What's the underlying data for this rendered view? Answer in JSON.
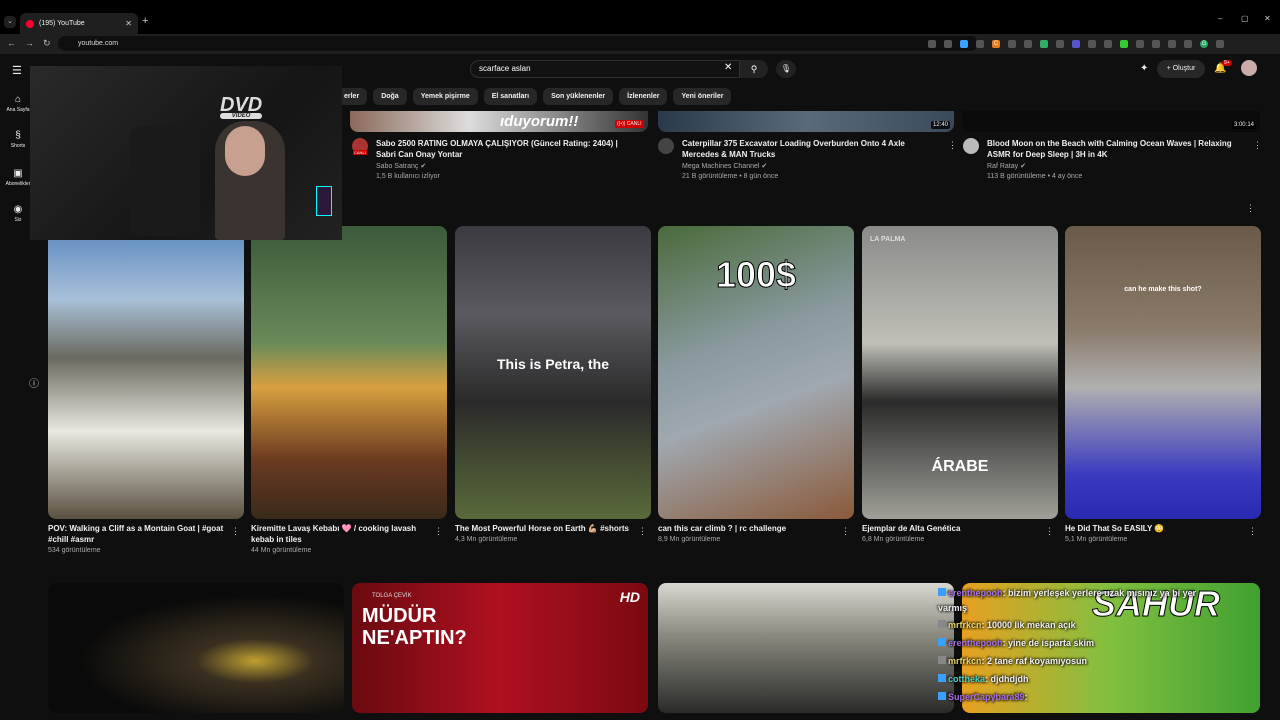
{
  "browser": {
    "tab_title": "(195) YouTube",
    "new_tab": "+",
    "url": "youtube.com",
    "window_controls": [
      "–",
      "▢",
      "✕"
    ],
    "ext_labels": [
      "C",
      "G"
    ]
  },
  "youtube": {
    "search_query": "scarface aslan",
    "create_label": "Oluştur",
    "notification_count": "9+",
    "chips": [
      "erler",
      "Doğa",
      "Yemek pişirme",
      "El sanatları",
      "Son yüklenenler",
      "İzlenenler",
      "Yeni öneriler"
    ],
    "sidebar": [
      {
        "label": "Ana Sayfa",
        "icon": "home-icon"
      },
      {
        "label": "Shorts",
        "icon": "shorts-icon"
      },
      {
        "label": "Abonelikler",
        "icon": "subscriptions-icon"
      },
      {
        "label": "Siz",
        "icon": "you-icon"
      }
    ],
    "top_videos": [
      {
        "title": "Sabo 2500 RATING OLMAYA ÇALIŞIYOR (Güncel Rating: 2404) | Sabri Can Onay Yontar",
        "channel": "Sabo Satranç ✔",
        "stats": "1,5 B kullanıcı izliyor",
        "badge": "CANLI",
        "thumb_text": "ıduyorum!!",
        "thumb_badge": "((•)) CANLI"
      },
      {
        "title": "Caterpillar 375 Excavator Loading Overburden Onto 4 Axle Mercedes & MAN Trucks",
        "channel": "Mega Machines Channel ✔",
        "stats": "21 B görüntüleme • 8 gün önce",
        "duration": "12:40"
      },
      {
        "title": "Blood Moon on the Beach with Calming Ocean Waves | Relaxing ASMR for Deep Sleep | 3H in 4K",
        "channel": "Raf Ratay ✔",
        "stats": "113 B görüntüleme • 4 ay önce",
        "duration": "3:00:14"
      }
    ],
    "shorts": [
      {
        "title": "POV: Walking a Cliff as a Montain Goat | #goat #chill #asmr",
        "views": "534 görüntüleme",
        "overlay": ""
      },
      {
        "title": "Kiremitte Lavaş Kebabı 🩷 / cooking lavash kebab in tiles",
        "views": "44 Mn görüntüleme",
        "overlay": ""
      },
      {
        "title": "The Most Powerful Horse on Earth 💪🏼 #shorts",
        "views": "4,3 Mn görüntüleme",
        "overlay": "This is Petra, the"
      },
      {
        "title": "can this car climb ? | rc challenge",
        "views": "8,9 Mn görüntüleme",
        "overlay": "100$"
      },
      {
        "title": "Ejemplar de Alta Genética",
        "views": "6,8 Mn görüntüleme",
        "overlay": "ÁRABE",
        "top_label": "LA PALMA"
      },
      {
        "title": "He Did That So EASILY 😳",
        "views": "5,1 Mn görüntüleme",
        "overlay": "can he make this shot?"
      }
    ],
    "bottom_thumbs": [
      {
        "text": ""
      },
      {
        "text": "MÜDÜR NE'APTIN?",
        "small": "TOLGA ÇEVİK",
        "hd": "HD"
      },
      {
        "text": ""
      },
      {
        "text": "SAHUR"
      }
    ]
  },
  "stream_overlay": {
    "dvd_text": "DVD",
    "dvd_sub": "VIDEO"
  },
  "chat": [
    {
      "user": "erenthepooh",
      "msg": ": bizim yerleşek yerlere uzak mısınız ya bi yer",
      "color": "u2"
    },
    {
      "user": "",
      "msg": "varmış",
      "color": ""
    },
    {
      "user": "mrfrkcn",
      "msg": ": 10000 lik mekan açık",
      "color": "u"
    },
    {
      "user": "erenthepooh",
      "msg": ": yine de isparta skim",
      "color": "u2"
    },
    {
      "user": "mrfrkcn",
      "msg": ": 2 tane raf koyamıyosun",
      "color": "u"
    },
    {
      "user": "cottheka",
      "msg": ": djdhdjdh",
      "color": "u3"
    },
    {
      "user": "SuperCapybara89",
      "msg": ":",
      "color": "u2"
    }
  ]
}
